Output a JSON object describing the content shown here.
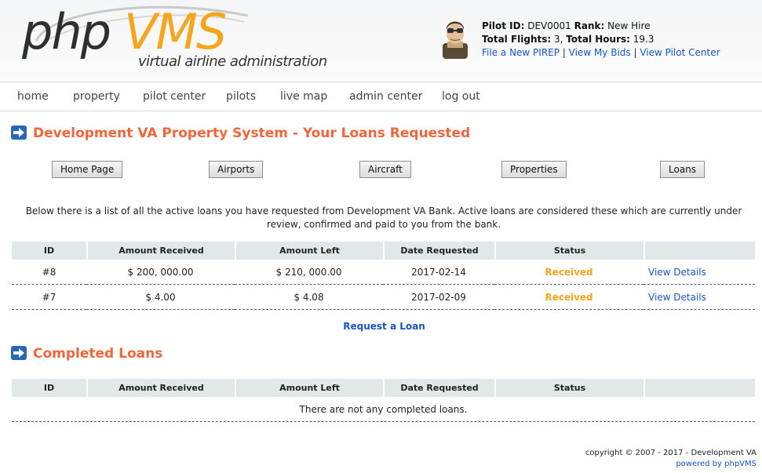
{
  "header": {
    "logo_php": "php",
    "logo_vms": "VMS",
    "tagline": "virtual airline administration",
    "pilot": {
      "id_label": "Pilot ID:",
      "id_value": " DEV0001 ",
      "rank_label": "Rank:",
      "rank_value": " New Hire",
      "flights_label": "Total Flights:",
      "flights_value": " 3, ",
      "hours_label": "Total Hours:",
      "hours_value": " 19.3",
      "links": [
        "File a New PIREP",
        "View My Bids",
        "View Pilot Center"
      ],
      "link_sep": " | "
    }
  },
  "nav": [
    "home",
    "property",
    "pilot center",
    "pilots",
    "live map",
    "admin center",
    "log out"
  ],
  "page": {
    "title": "Development VA Property System - Your Loans Requested",
    "buttons": [
      "Home Page",
      "Airports",
      "Aircraft",
      "Properties",
      "Loans"
    ],
    "intro": "Below there is a list of all the active loans you have requested from Development VA Bank. Active loans are considered these which are currently under review, confirmed and paid to you from the bank.",
    "table_headers": [
      "ID",
      "Amount Received",
      "Amount Left",
      "Date Requested",
      "Status",
      ""
    ],
    "loans": [
      {
        "id": "#8",
        "received": "$ 200, 000.00",
        "left": "$ 210, 000.00",
        "date": "2017-02-14",
        "status": "Received",
        "link": "View Details"
      },
      {
        "id": "#7",
        "received": "$ 4.00",
        "left": "$ 4.08",
        "date": "2017-02-09",
        "status": "Received",
        "link": "View Details"
      }
    ],
    "request_link": "Request a Loan",
    "completed_title": "Completed Loans",
    "completed_empty": "There are not any completed loans."
  },
  "footer": {
    "copyright": "copyright © 2007 - 2017 - Development VA",
    "powered": "powered by phpVMS"
  },
  "colors": {
    "accent_orange": "#f0663a",
    "logo_orange": "#f7a51d",
    "link_blue": "#1a55c0",
    "header_bg": "#e2e8e8"
  }
}
